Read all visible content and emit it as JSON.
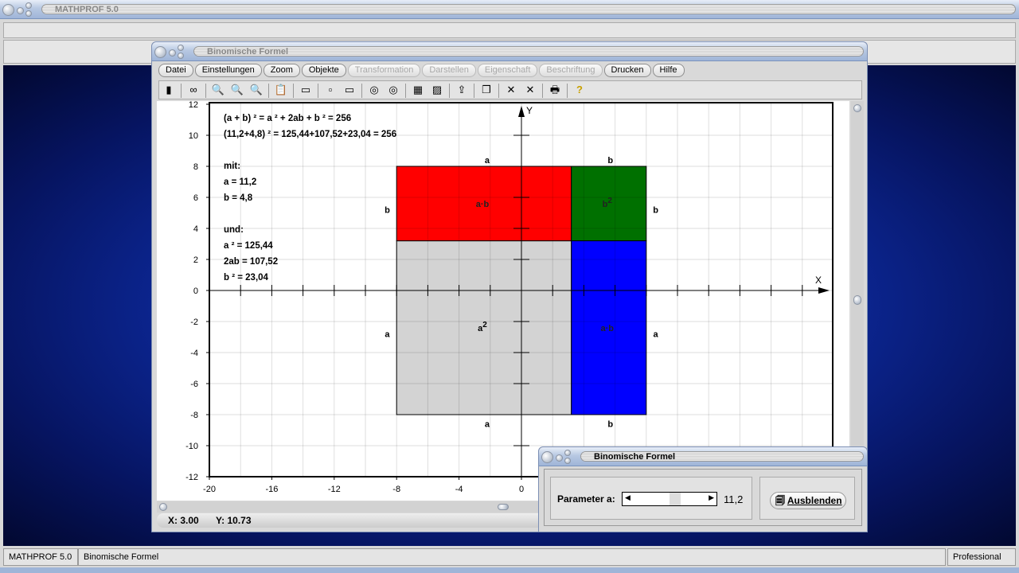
{
  "app": {
    "title": "MATHPROF 5.0"
  },
  "window": {
    "title": "Binomische Formel",
    "menu": [
      {
        "label": "Datei",
        "enabled": true
      },
      {
        "label": "Einstellungen",
        "enabled": true
      },
      {
        "label": "Zoom",
        "enabled": true
      },
      {
        "label": "Objekte",
        "enabled": true
      },
      {
        "label": "Transformation",
        "enabled": false
      },
      {
        "label": "Darstellen",
        "enabled": false
      },
      {
        "label": "Eigenschaft",
        "enabled": false
      },
      {
        "label": "Beschriftung",
        "enabled": false
      },
      {
        "label": "Drucken",
        "enabled": true
      },
      {
        "label": "Hilfe",
        "enabled": true
      }
    ],
    "toolbar": [
      "panel-icon",
      "glasses-icon",
      "zoom-out-icon",
      "zoom-reset-icon",
      "zoom-in-icon",
      "clipboard-icon",
      "window-icon",
      "box-icon",
      "box2-icon",
      "circle-icon",
      "circle2-icon",
      "table-icon",
      "image-icon",
      "export-icon",
      "copy-icon",
      "cross-icon",
      "cross2-icon",
      "print-icon",
      "help-icon"
    ],
    "coords": {
      "x": "X: 3.00",
      "y": "Y: 10.73"
    }
  },
  "chart_data": {
    "type": "area",
    "xlim": [
      -20,
      20
    ],
    "ylim": [
      -12,
      12
    ],
    "grid": true,
    "grid_step": 2,
    "xticks": [
      -20,
      -16,
      -12,
      -8,
      -4,
      0
    ],
    "yticks": [
      12,
      10,
      8,
      6,
      4,
      2,
      0,
      -2,
      -4,
      -6,
      -8,
      -10,
      -12
    ],
    "xlabel": "X",
    "ylabel": "Y",
    "rects": [
      {
        "name": "a^2",
        "x": [
          -8,
          3.2
        ],
        "y": [
          -8,
          3.2
        ],
        "color": "#d3d3d3",
        "label": "a",
        "sup": "2"
      },
      {
        "name": "ab-top",
        "x": [
          -8,
          3.2
        ],
        "y": [
          3.2,
          8
        ],
        "color": "#ff0000",
        "label": "a·b",
        "sup": ""
      },
      {
        "name": "b^2",
        "x": [
          3.2,
          8
        ],
        "y": [
          3.2,
          8
        ],
        "color": "#007000",
        "label": "b",
        "sup": "2"
      },
      {
        "name": "ab-right",
        "x": [
          3.2,
          8
        ],
        "y": [
          -8,
          3.2
        ],
        "color": "#0000ff",
        "label": "a·b",
        "sup": ""
      }
    ],
    "side_labels": [
      {
        "t": "a",
        "x": -2.2,
        "y": 8.4
      },
      {
        "t": "b",
        "x": 5.7,
        "y": 8.4
      },
      {
        "t": "b",
        "x": -8.6,
        "y": 5.2
      },
      {
        "t": "b",
        "x": 8.6,
        "y": 5.2
      },
      {
        "t": "a",
        "x": -8.6,
        "y": -2.8
      },
      {
        "t": "a",
        "x": 8.6,
        "y": -2.8
      },
      {
        "t": "a",
        "x": -2.2,
        "y": -8.6
      },
      {
        "t": "b",
        "x": 5.7,
        "y": -8.6
      }
    ],
    "text_lines": [
      "(a + b) ² = a ² + 2ab + b ² = 256",
      "(11,2+4,8) ²  = 125,44+107,52+23,04 = 256",
      "",
      "mit:",
      "a = 11,2",
      "b = 4,8",
      "",
      "und:",
      "a ² = 125,44",
      "2ab = 107,52",
      "b ² = 23,04"
    ]
  },
  "dialog": {
    "title": "Binomische Formel",
    "param_label": "Parameter a:",
    "param_value": "11,2",
    "param_fraction": 0.6,
    "hide_button": "Ausblenden"
  },
  "statusbar": {
    "app": "MATHPROF 5.0",
    "doc": "Binomische Formel",
    "edition": "Professional"
  }
}
